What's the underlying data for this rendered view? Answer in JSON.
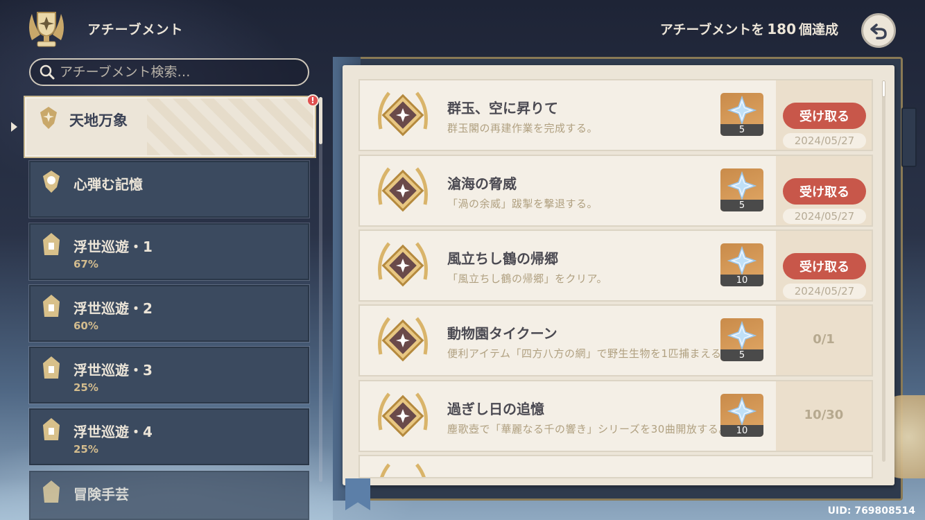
{
  "header": {
    "title": "アチーブメント",
    "count_prefix": "アチーブメントを",
    "count_value": "180",
    "count_suffix": "個達成"
  },
  "search": {
    "placeholder": "アチーブメント検索…"
  },
  "categories": [
    {
      "label": "天地万象",
      "percent": "",
      "active": true,
      "has_alert": true
    },
    {
      "label": "心弾む記憶",
      "percent": ""
    },
    {
      "label": "浮世巡遊・1",
      "percent": "67%"
    },
    {
      "label": "浮世巡遊・2",
      "percent": "60%"
    },
    {
      "label": "浮世巡遊・3",
      "percent": "25%"
    },
    {
      "label": "浮世巡遊・4",
      "percent": "25%"
    },
    {
      "label": "冒険手芸",
      "percent": ""
    }
  ],
  "alert_mark": "!",
  "achievements": [
    {
      "title": "群玉、空に昇りて",
      "desc": "群玉閣の再建作業を完成する。",
      "reward_qty": "5",
      "button": "受け取る",
      "date": "2024/05/27"
    },
    {
      "title": "滄海の脅威",
      "desc": "「渦の余威」跋掣を撃退する。",
      "reward_qty": "5",
      "button": "受け取る",
      "date": "2024/05/27"
    },
    {
      "title": "風立ちし鶴の帰郷",
      "desc": "「風立ちし鶴の帰郷」をクリア。",
      "reward_qty": "10",
      "button": "受け取る",
      "date": "2024/05/27"
    },
    {
      "title": "動物園タイクーン",
      "desc": "便利アイテム「四方八方の網」で野生生物を1匹捕まえる。",
      "reward_qty": "5",
      "progress": "0/1"
    },
    {
      "title": "過ぎし日の追憶",
      "desc": "塵歌壺で「華麗なる千の響き」シリーズを30曲開放する。",
      "reward_qty": "10",
      "progress": "10/30"
    }
  ],
  "uid": "UID: 769808514",
  "colors": {
    "claim": "#c8574a",
    "page": "#ece5d8",
    "gold": "#d3bc8e"
  }
}
